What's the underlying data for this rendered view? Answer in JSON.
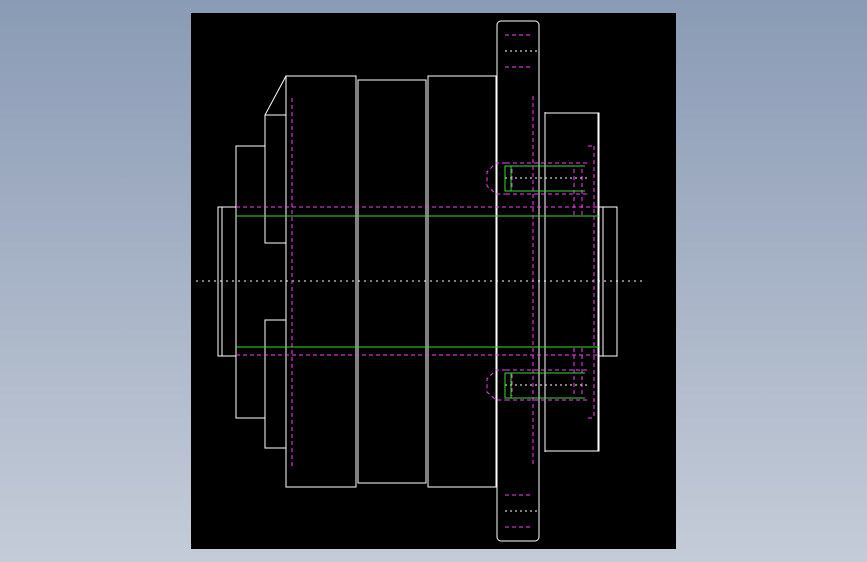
{
  "drawing": {
    "title": "",
    "colors": {
      "background_outer": "#8a9bb5",
      "viewport": "#000000",
      "outline": "#ffffff",
      "hidden": "#ff3cff",
      "center": "#33dd33",
      "axis": "#ffffff"
    }
  }
}
